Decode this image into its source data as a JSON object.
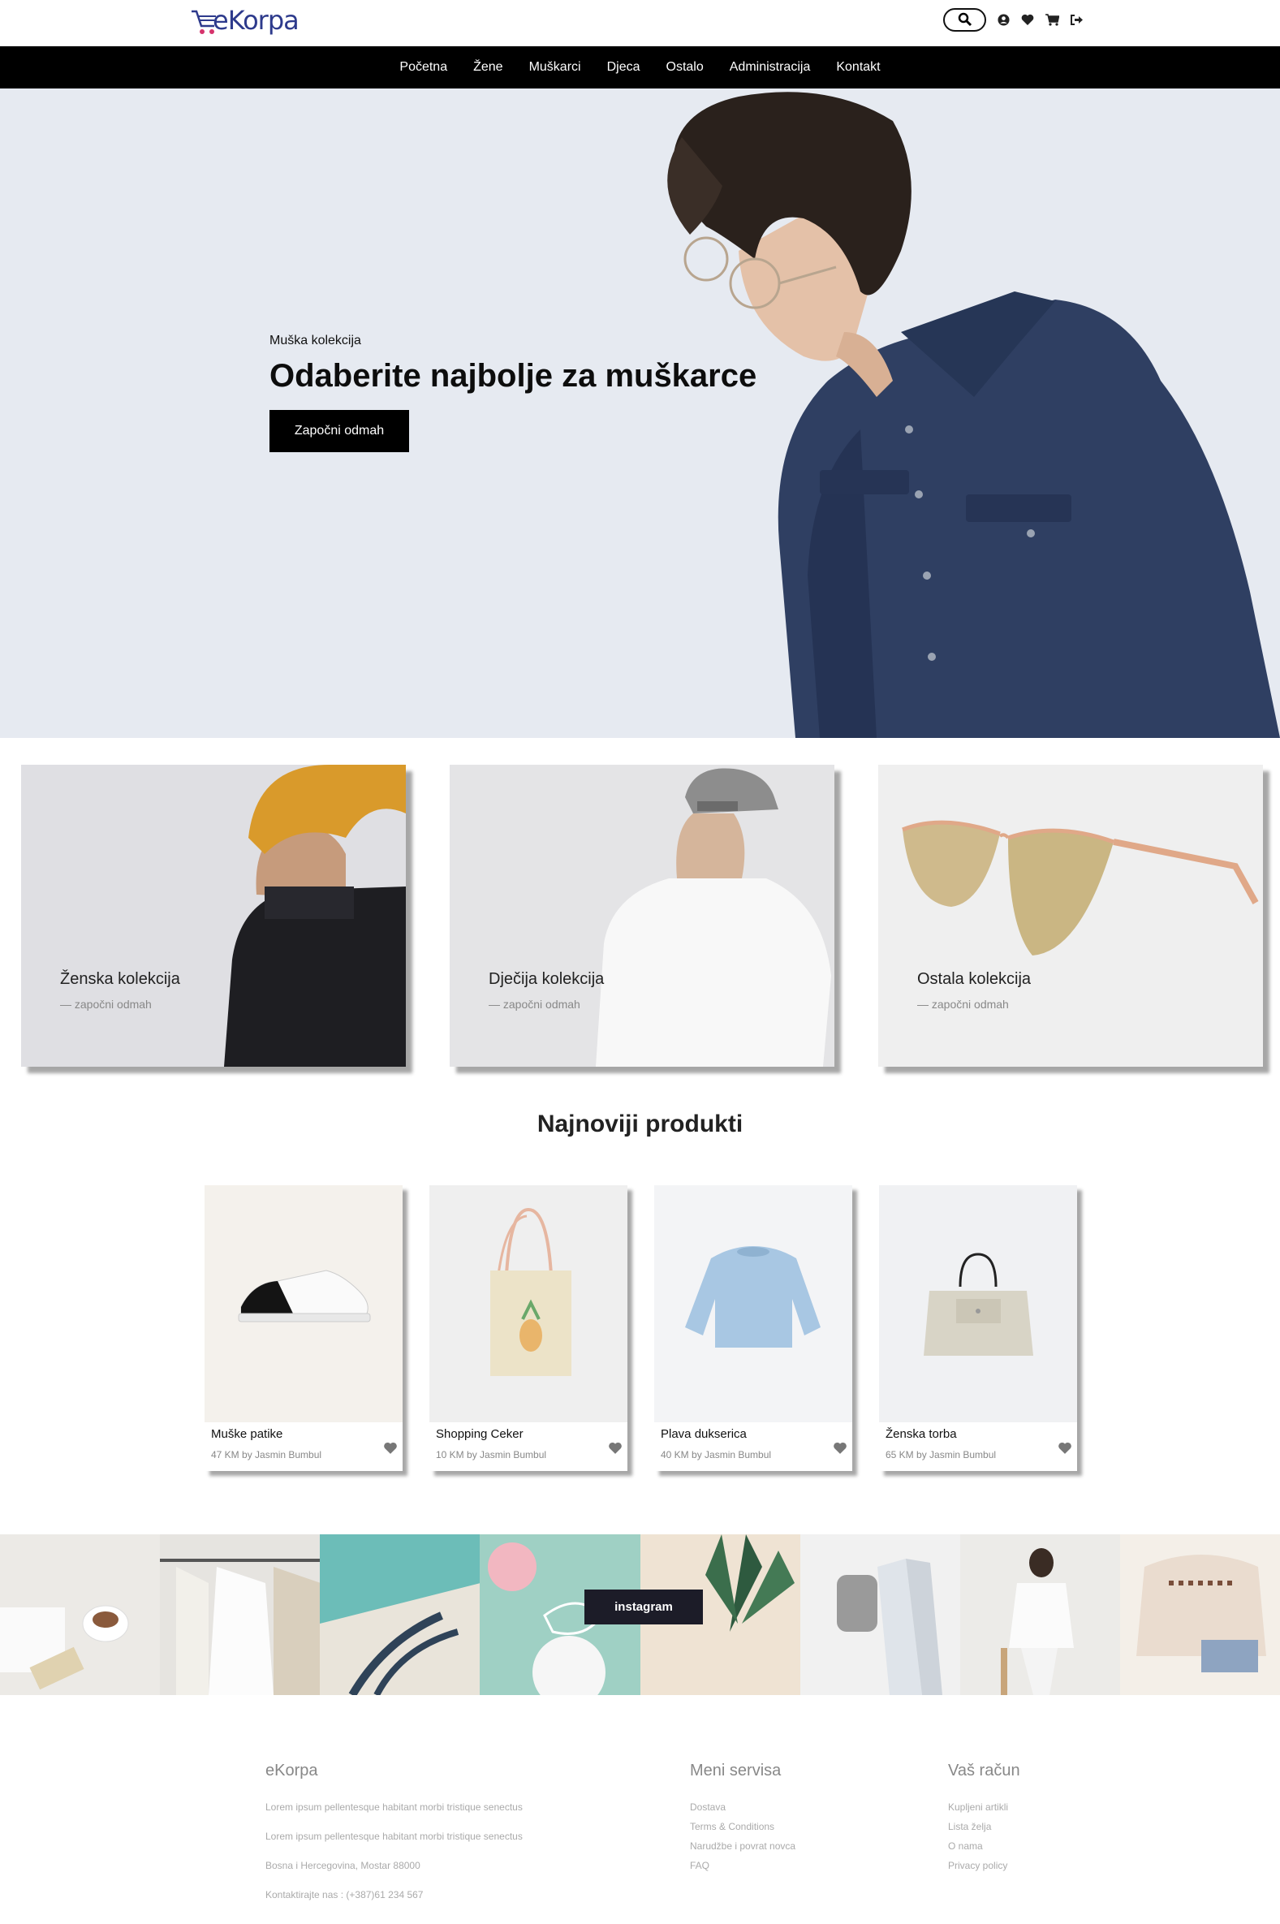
{
  "header": {
    "logo_text": "eKorpa",
    "icons": [
      "search-icon",
      "user-icon",
      "heart-icon",
      "cart-icon",
      "logout-icon"
    ]
  },
  "nav": {
    "items": [
      "Početna",
      "Žene",
      "Muškarci",
      "Djeca",
      "Ostalo",
      "Administracija",
      "Kontakt"
    ]
  },
  "hero": {
    "subtitle": "Muška kolekcija",
    "title": "Odaberite najbolje za muškarce",
    "button": "Započni odmah"
  },
  "collections": [
    {
      "title": "Ženska kolekcija",
      "link": "— započni odmah"
    },
    {
      "title": "Dječija kolekcija",
      "link": "— započni odmah"
    },
    {
      "title": "Ostala kolekcija",
      "link": "— započni odmah"
    }
  ],
  "products_section": {
    "title": "Najnoviji produkti"
  },
  "products": [
    {
      "name": "Muške patike",
      "meta": "47 KM by Jasmin Bumbul"
    },
    {
      "name": "Shopping Ceker",
      "meta": "10 KM by Jasmin Bumbul"
    },
    {
      "name": "Plava dukserica",
      "meta": "40 KM by Jasmin Bumbul"
    },
    {
      "name": "Ženska torba",
      "meta": "65 KM by Jasmin Bumbul"
    }
  ],
  "instagram": {
    "button": "instagram"
  },
  "footer": {
    "col1": {
      "title": "eKorpa",
      "lines": [
        "Lorem ipsum pellentesque habitant morbi tristique senectus",
        "Lorem ipsum pellentesque habitant morbi tristique senectus",
        "Bosna i Hercegovina, Mostar 88000",
        "Kontaktirajte nas : (+387)61 234 567"
      ]
    },
    "col2": {
      "title": "Meni servisa",
      "links": [
        "Dostava",
        "Terms & Conditions",
        "Narudžbe i povrat novca",
        "FAQ"
      ]
    },
    "col3": {
      "title": "Vaš račun",
      "links": [
        "Kupljeni artikli",
        "Lista želja",
        "O nama",
        "Privacy policy"
      ]
    }
  },
  "colors": {
    "nav_bg": "#000000",
    "hero_bg": "#e6eaf1",
    "brand": "#2d3a8c",
    "accent_pink": "#d6336c"
  }
}
